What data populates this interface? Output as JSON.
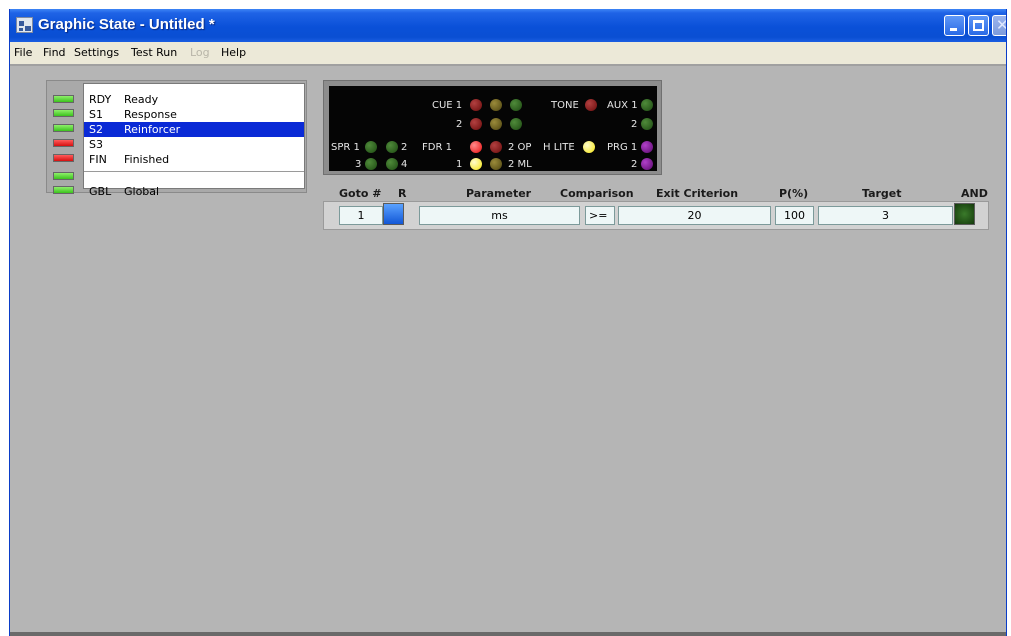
{
  "window": {
    "title": "Graphic State - Untitled *"
  },
  "menu": [
    {
      "label": "File",
      "enabled": true
    },
    {
      "label": "Find",
      "enabled": true
    },
    {
      "label": "Settings",
      "enabled": true
    },
    {
      "label": "Test Run",
      "enabled": true
    },
    {
      "label": "Log",
      "enabled": false
    },
    {
      "label": "Help",
      "enabled": true
    }
  ],
  "states": [
    {
      "code": "RDY",
      "label": "Ready",
      "led": "green",
      "selected": false
    },
    {
      "code": "S1",
      "label": "Response",
      "led": "green",
      "selected": false
    },
    {
      "code": "S2",
      "label": "Reinforcer",
      "led": "green",
      "selected": true
    },
    {
      "code": "S3",
      "label": "",
      "led": "red",
      "selected": false
    },
    {
      "code": "FIN",
      "label": "Finished",
      "led": "red",
      "selected": false
    },
    {
      "code": "",
      "label": "",
      "led": "green",
      "selected": false
    },
    {
      "code": "GBL",
      "label": "Global",
      "led": "green",
      "selected": false
    }
  ],
  "indicators": {
    "cue1": "CUE 1",
    "cue2": "2",
    "tone": "TONE",
    "aux1": "AUX 1",
    "aux2": "2",
    "spr1": "SPR 1",
    "spr2": "2",
    "spr3": "3",
    "spr4": "4",
    "fdr1": "FDR 1",
    "fdr_1": "1",
    "op": "2 OP",
    "ml": "2 ML",
    "hlite": "H LITE",
    "prg1": "PRG 1",
    "prg2": "2"
  },
  "columns": {
    "goto": "Goto #",
    "r": "R",
    "parameter": "Parameter",
    "comparison": "Comparison",
    "exit": "Exit Criterion",
    "p": "P(%)",
    "target": "Target",
    "and": "AND"
  },
  "condition": {
    "goto": "1",
    "parameter": "ms",
    "comparison": ">=",
    "exit_criterion": "20",
    "p": "100",
    "target": "3"
  }
}
